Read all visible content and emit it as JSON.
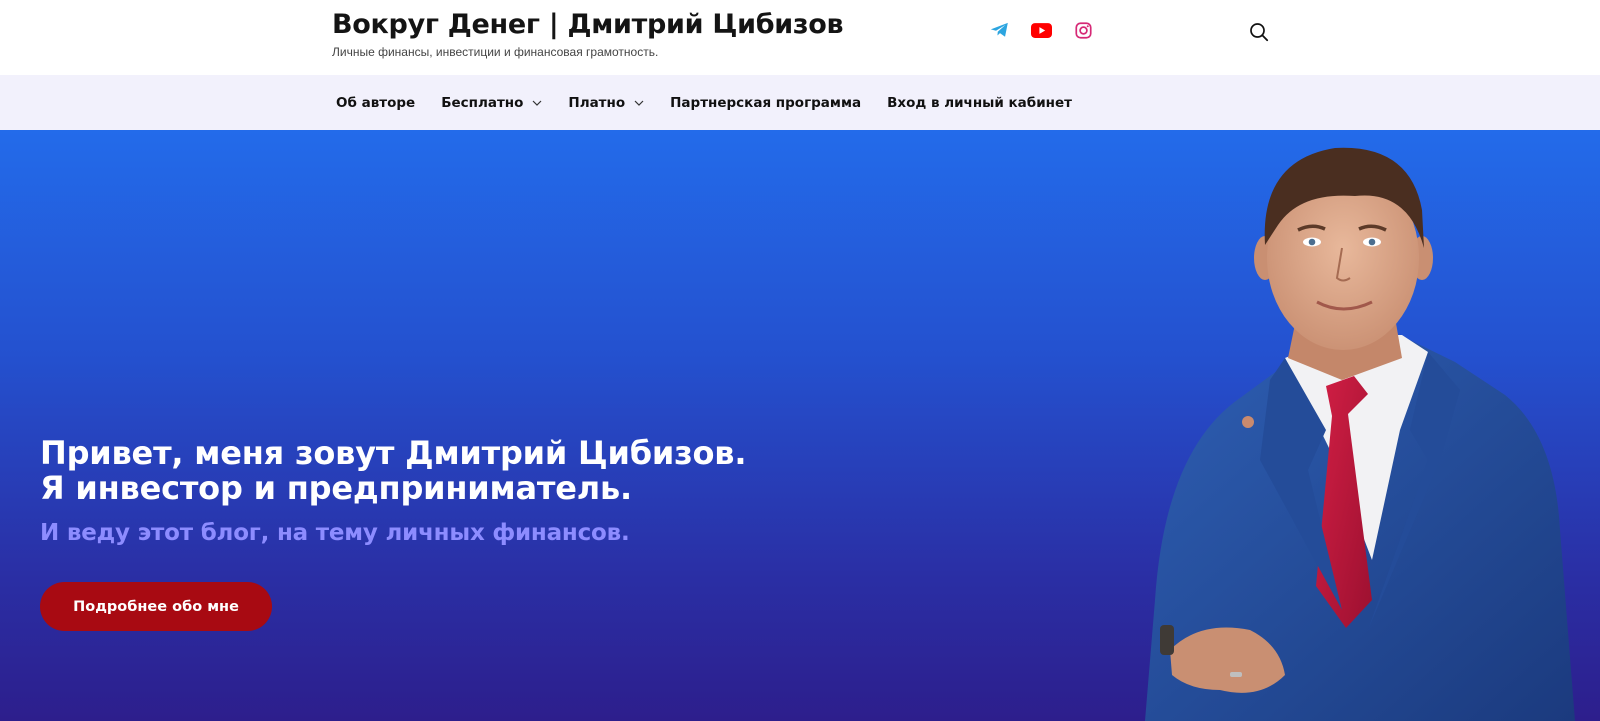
{
  "header": {
    "title": "Вокруг Денег | Дмитрий Цибизов",
    "tagline": "Личные финансы, инвестиции и финансовая грамотность."
  },
  "social": [
    {
      "name": "telegram",
      "icon": "telegram-icon",
      "color": "#2ca5e0"
    },
    {
      "name": "youtube",
      "icon": "youtube-icon",
      "color": "#ff0000"
    },
    {
      "name": "instagram",
      "icon": "instagram-icon",
      "color": "#d62976"
    }
  ],
  "search": {
    "icon": "search-icon"
  },
  "nav": {
    "items": [
      {
        "label": "Об авторе",
        "dropdown": false
      },
      {
        "label": "Бесплатно",
        "dropdown": true
      },
      {
        "label": "Платно",
        "dropdown": true
      },
      {
        "label": "Партнерская программа",
        "dropdown": false
      },
      {
        "label": "Вход в личный кабинет",
        "dropdown": false
      }
    ]
  },
  "hero": {
    "title_line1": "Привет, меня зовут Дмитрий Цибизов.",
    "title_line2": "Я инвестор и предприниматель.",
    "subtitle": "И веду этот блог, на тему личных финансов.",
    "button_label": "Подробнее обо мне",
    "colors": {
      "gradient_top": "#236bea",
      "gradient_bottom": "#2d1e8c",
      "subtitle": "#8d8cff",
      "button": "#a80a12"
    }
  }
}
